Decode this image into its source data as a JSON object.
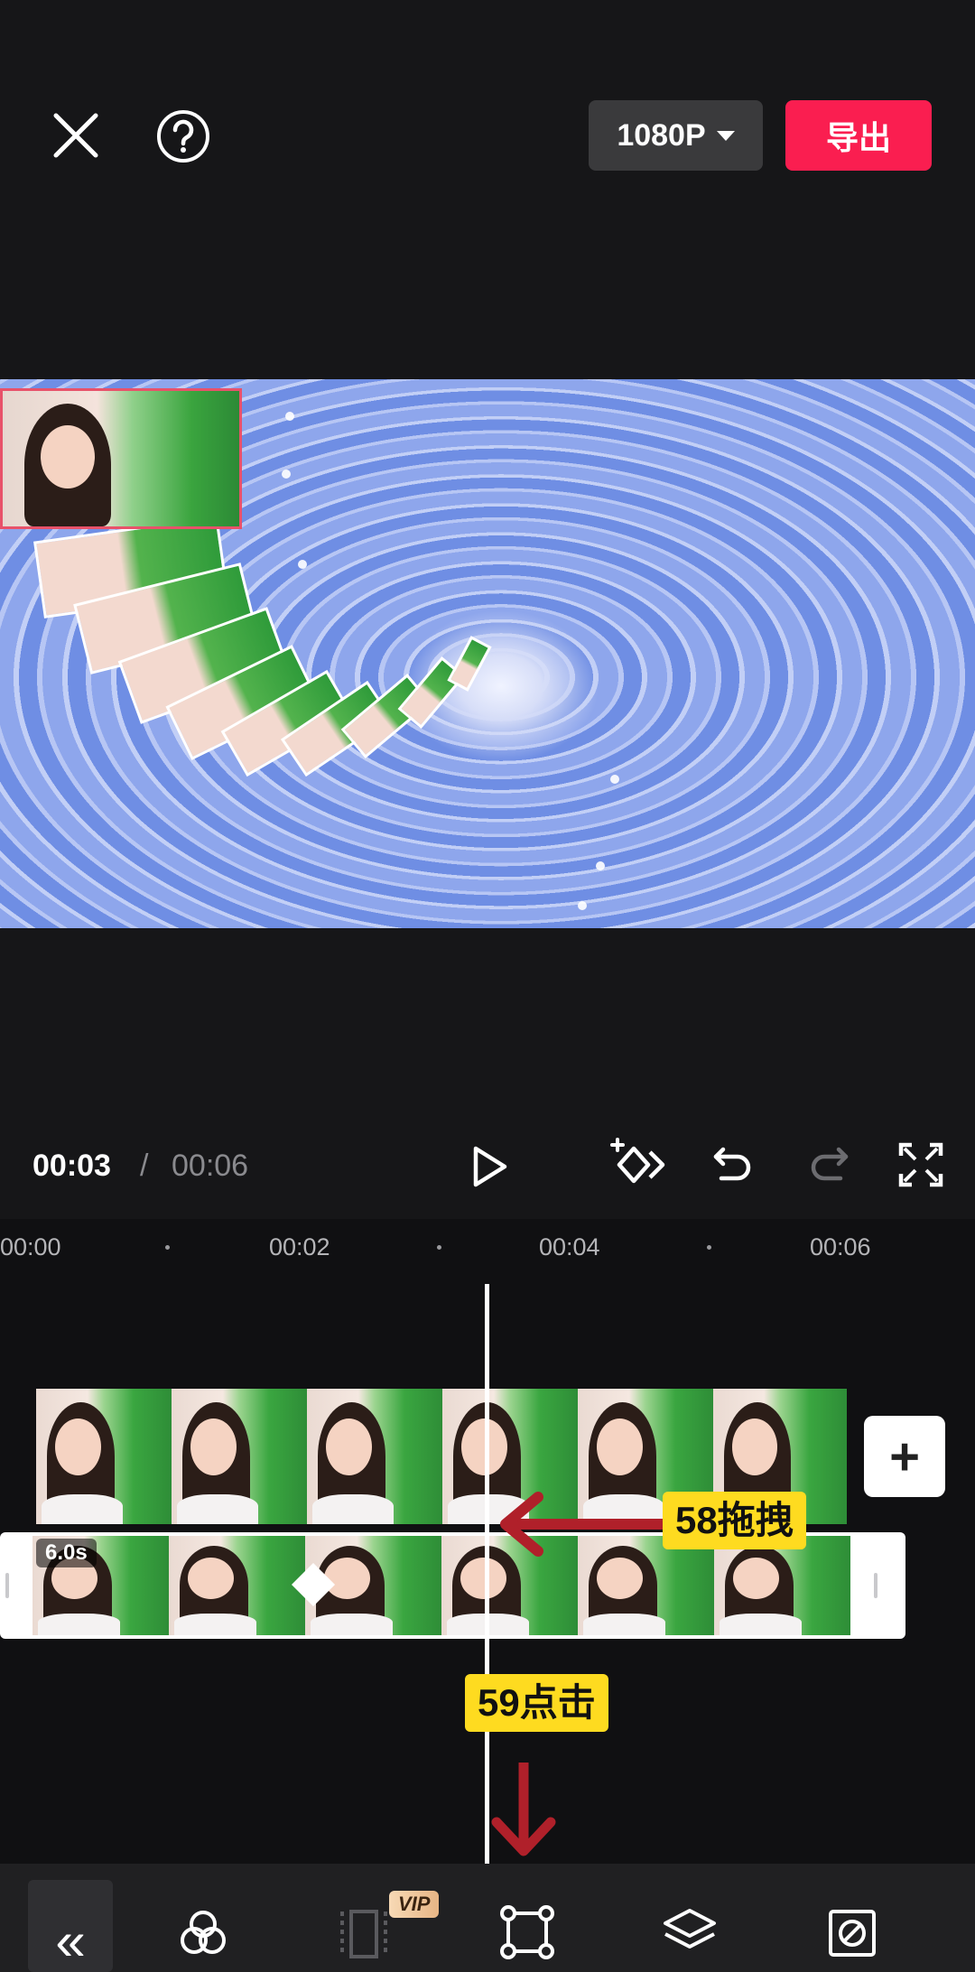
{
  "topbar": {
    "close_icon": "close-icon",
    "help_icon": "help-icon",
    "resolution": "1080P",
    "export_label": "导出"
  },
  "controls": {
    "current_time": "00:03",
    "separator": "/",
    "total_time": "00:06",
    "icons": [
      "play-icon",
      "add-keyframe-icon",
      "undo-icon",
      "redo-icon",
      "fullscreen-icon"
    ]
  },
  "timeline": {
    "ruler": [
      "00:00",
      "00:02",
      "00:04",
      "00:06"
    ],
    "clip_duration": "6.0s",
    "add_label": "+"
  },
  "annotations": {
    "drag_label": "58拖拽",
    "tap_label": "59点击"
  },
  "toolbar": {
    "back_label": "«",
    "vip_badge": "VIP",
    "items": [
      "filter-icon",
      "split-icon",
      "crop-icon",
      "layers-icon",
      "mask-icon"
    ]
  },
  "colors": {
    "background": "#161618",
    "export": "#fa1e50",
    "annotation": "#fedb20",
    "arrow": "#b0202a"
  }
}
